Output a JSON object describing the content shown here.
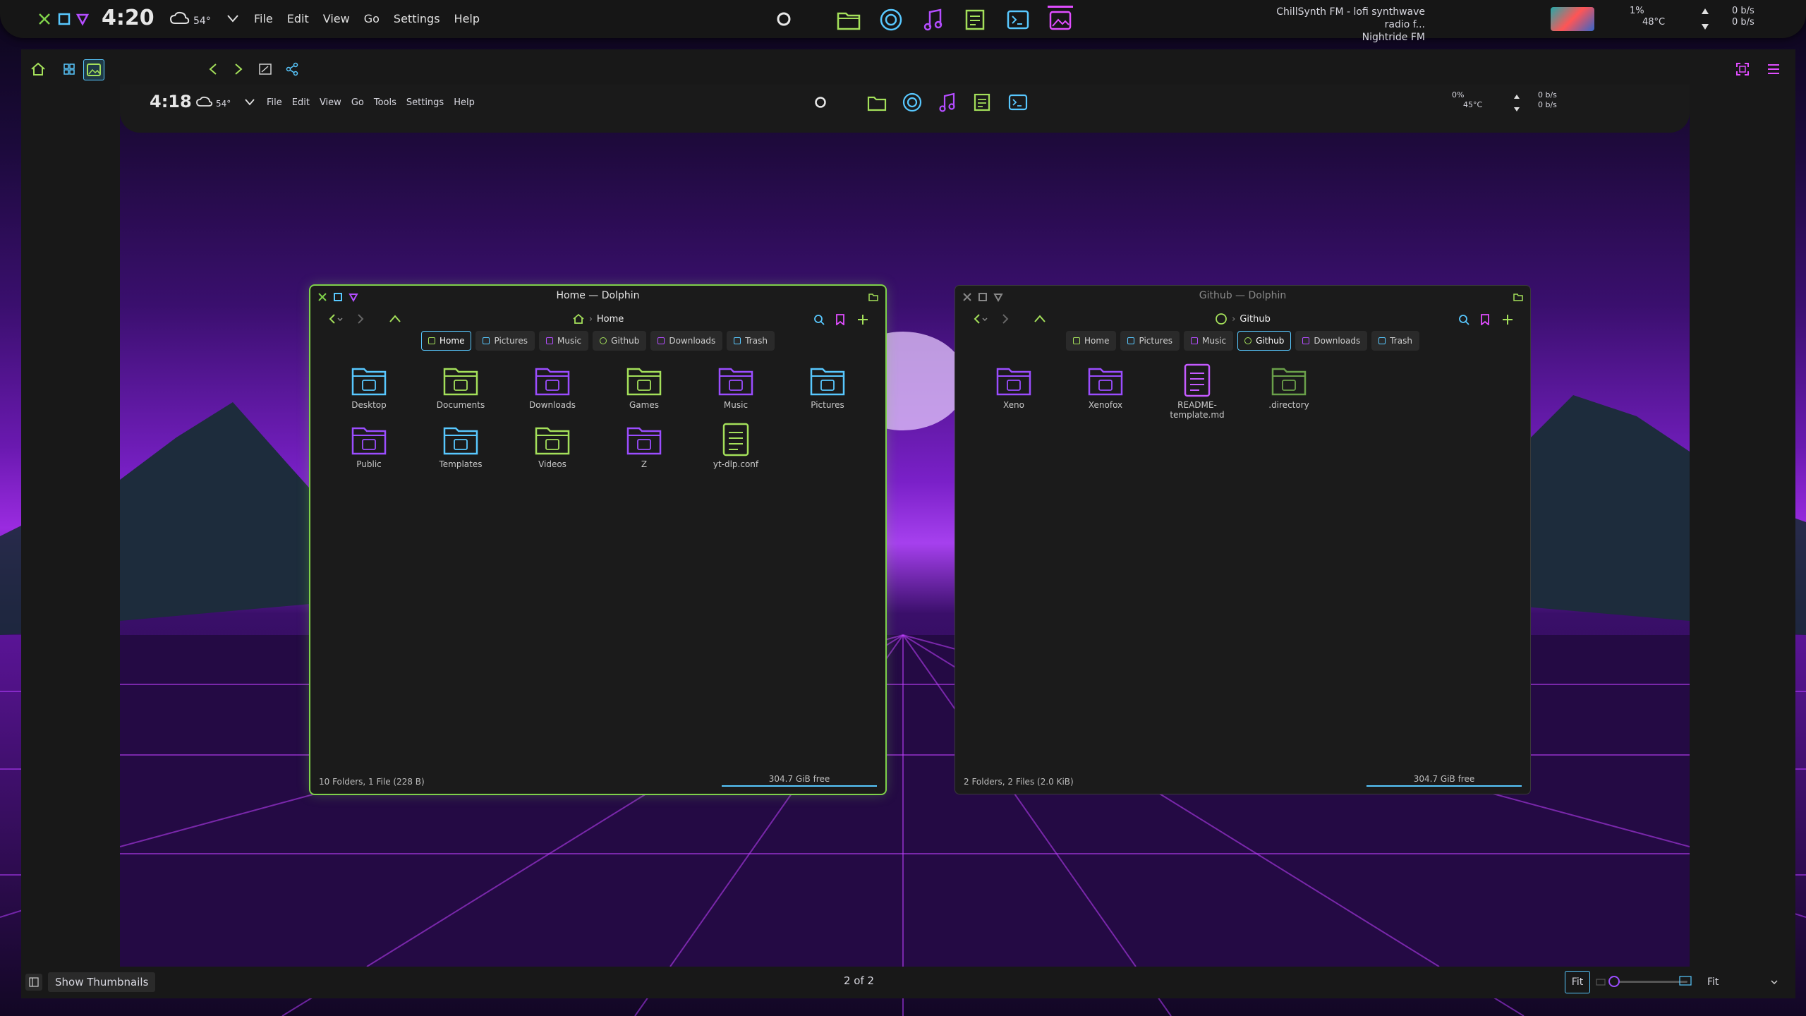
{
  "top_panel": {
    "clock": "4:20",
    "weather_temp": "54°",
    "menu": [
      "File",
      "Edit",
      "View",
      "Go",
      "Settings",
      "Help"
    ],
    "media_title": "ChillSynth FM - lofi synthwave radio f...",
    "media_artist": "Nightride FM",
    "cpu_percent": "1%",
    "cpu_temp": "48°C",
    "net_up": "0 b/s",
    "net_down": "0 b/s"
  },
  "viewer": {
    "status_left": "Show Thumbnails",
    "page_indicator": "2 of 2",
    "fit_button": "Fit",
    "zoom_mode": "Fit"
  },
  "inner": {
    "clock": "4:18",
    "weather_temp": "54°",
    "menu": [
      "File",
      "Edit",
      "View",
      "Go",
      "Tools",
      "Settings",
      "Help"
    ],
    "cpu_percent": "0%",
    "cpu_temp": "45°C",
    "net_up": "0 b/s",
    "net_down": "0 b/s"
  },
  "dolphin_left": {
    "title": "Home — Dolphin",
    "location": "Home",
    "tabs": [
      "Home",
      "Pictures",
      "Music",
      "Github",
      "Downloads",
      "Trash"
    ],
    "selected_tab": 0,
    "files": [
      {
        "name": "Desktop",
        "color": "#58c8ff"
      },
      {
        "name": "Documents",
        "color": "#a4e05a"
      },
      {
        "name": "Downloads",
        "color": "#9b4dff"
      },
      {
        "name": "Games",
        "color": "#a4e05a"
      },
      {
        "name": "Music",
        "color": "#9b4dff"
      },
      {
        "name": "Pictures",
        "color": "#58c8ff"
      },
      {
        "name": "Public",
        "color": "#9b4dff"
      },
      {
        "name": "Templates",
        "color": "#58c8ff"
      },
      {
        "name": "Videos",
        "color": "#a4e05a"
      },
      {
        "name": "Z",
        "color": "#9b4dff"
      },
      {
        "name": "yt-dlp.conf",
        "color": "#a4e05a"
      }
    ],
    "status": "10 Folders, 1 File (228 B)",
    "free": "304.7 GiB free"
  },
  "dolphin_right": {
    "title": "Github — Dolphin",
    "location": "Github",
    "tabs": [
      "Home",
      "Pictures",
      "Music",
      "Github",
      "Downloads",
      "Trash"
    ],
    "selected_tab": 3,
    "files": [
      {
        "name": "Xeno",
        "color": "#9b4dff"
      },
      {
        "name": "Xenofox",
        "color": "#9b4dff"
      },
      {
        "name": "README-template.md",
        "color": "#c45aff"
      },
      {
        "name": ".directory",
        "color": "#6aa04a"
      }
    ],
    "status": "2 Folders, 2 Files (2.0 KiB)",
    "free": "304.7 GiB free"
  },
  "colors": {
    "accent_green": "#7fd14a",
    "accent_blue": "#58c8ff",
    "accent_purple": "#9b4dff",
    "accent_pink": "#e04dff"
  }
}
